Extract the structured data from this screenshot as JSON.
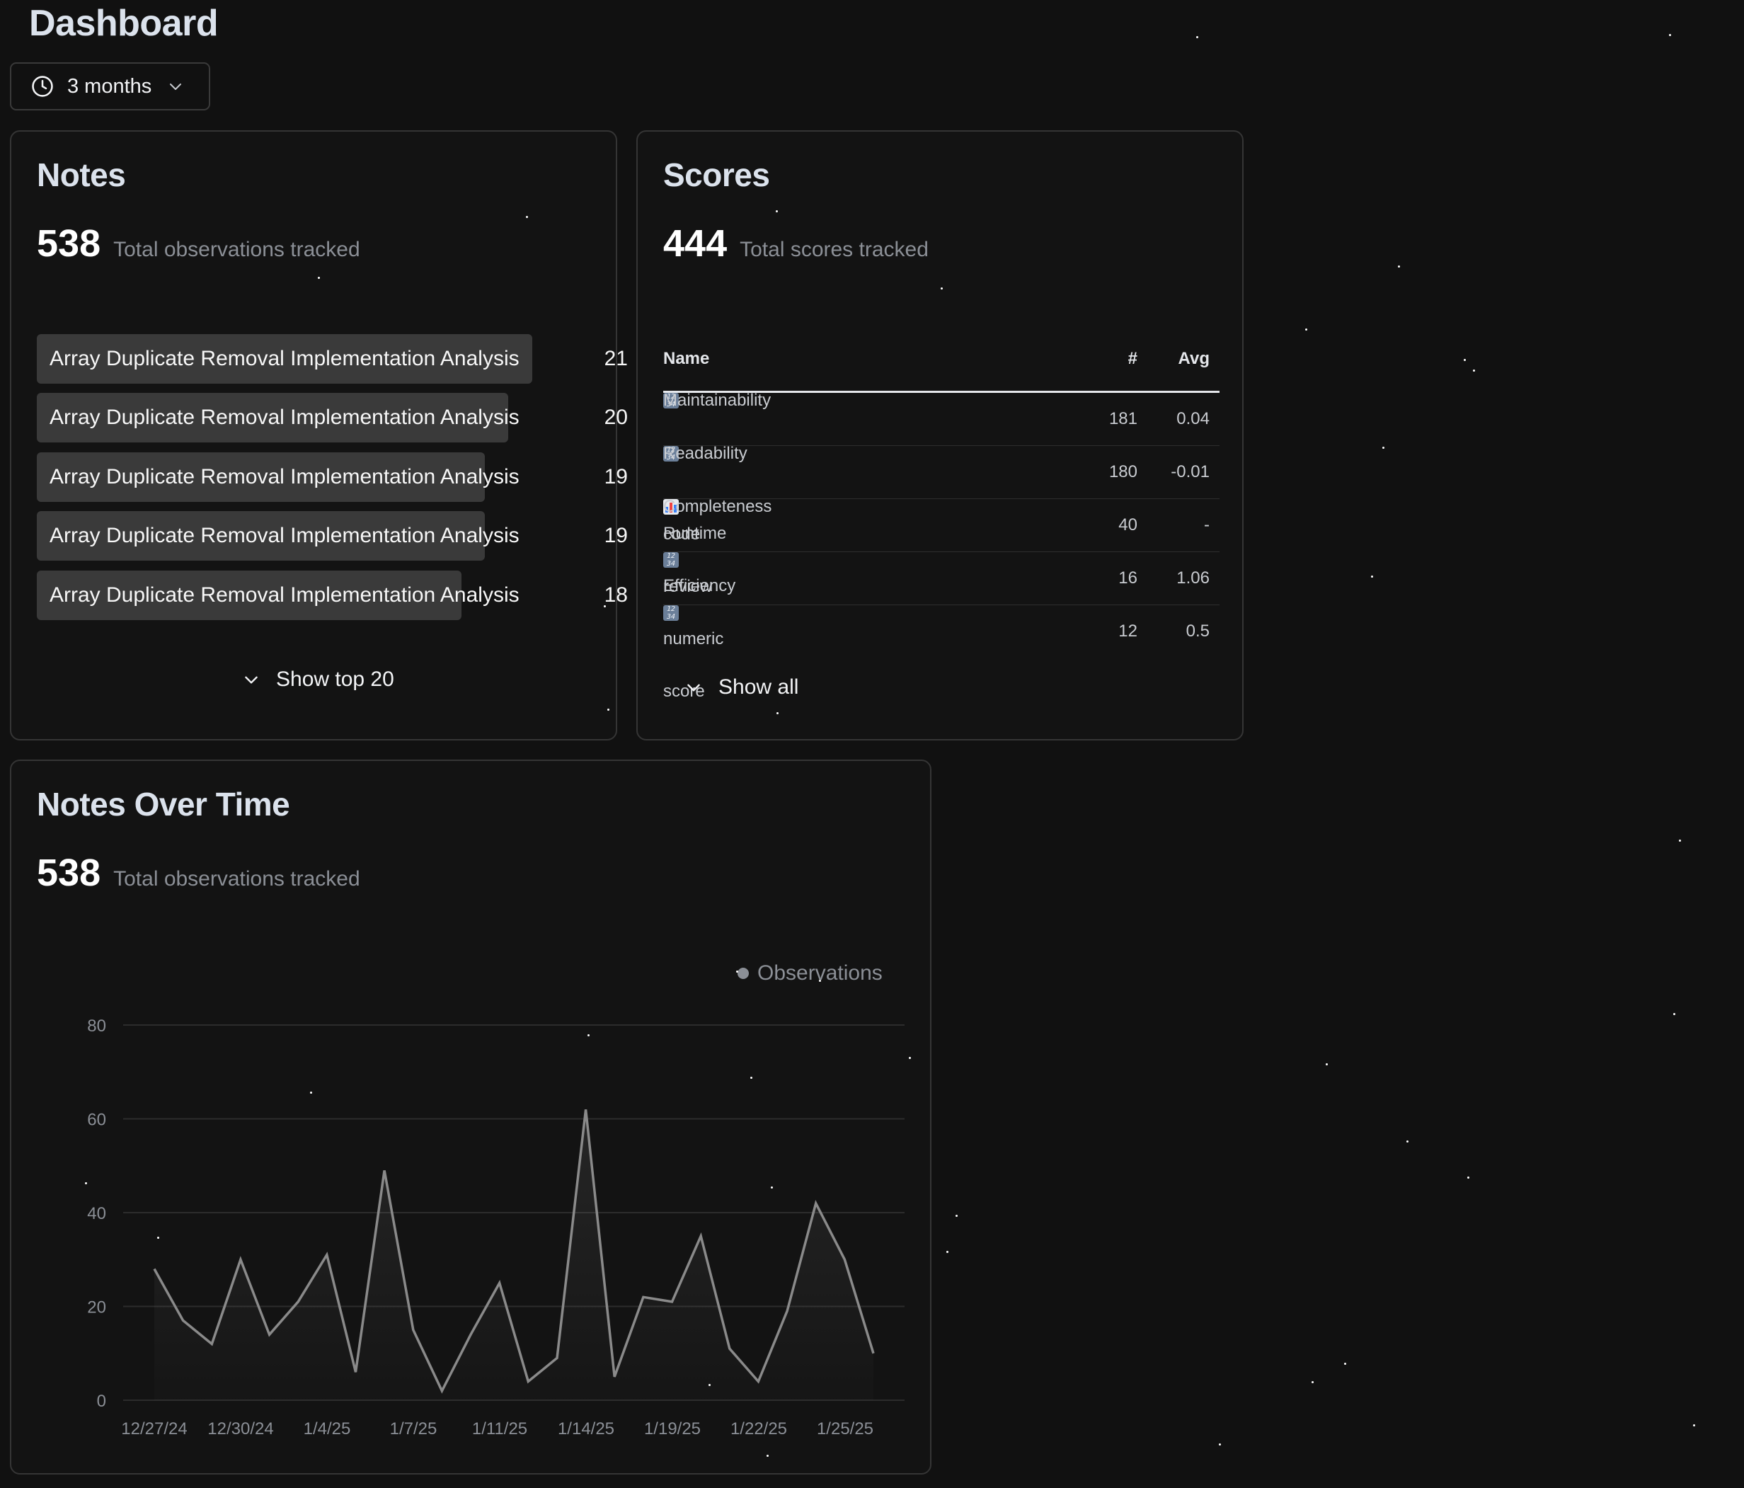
{
  "page": {
    "title": "Dashboard"
  },
  "range_select": {
    "value": "3 months",
    "icon": "clock-icon"
  },
  "notes_card": {
    "title": "Notes",
    "total": "538",
    "total_label": "Total observations tracked",
    "items": [
      {
        "label": "Array Duplicate Removal Implementation Analysis",
        "count": "21",
        "value": 21
      },
      {
        "label": "Array Duplicate Removal Implementation Analysis",
        "count": "20",
        "value": 20
      },
      {
        "label": "Array Duplicate Removal Implementation Analysis",
        "count": "19",
        "value": 19
      },
      {
        "label": "Array Duplicate Removal Implementation Analysis",
        "count": "19",
        "value": 19
      },
      {
        "label": "Array Duplicate Removal Implementation Analysis",
        "count": "18",
        "value": 18
      }
    ],
    "show_more_label": "Show top 20"
  },
  "scores_card": {
    "title": "Scores",
    "total": "444",
    "total_label": "Total scores tracked",
    "columns": {
      "name": "Name",
      "count": "#",
      "avg": "Avg"
    },
    "rows": [
      {
        "icon": "numeric-icon",
        "name": "Maintainability",
        "count": "181",
        "avg": "0.04"
      },
      {
        "icon": "numeric-icon",
        "name": "Readability",
        "count": "180",
        "avg": "-0.01"
      },
      {
        "icon": "bar-chart-icon",
        "name": "Completeness",
        "count": "40",
        "avg": "-"
      },
      {
        "icon": "numeric-icon",
        "name": "Runtime Efficiency",
        "count": "16",
        "avg": "1.06"
      },
      {
        "icon": "numeric-icon",
        "name": "code review numeric score",
        "count": "12",
        "avg": "0.5"
      }
    ],
    "show_all_label": "Show all"
  },
  "timeline_card": {
    "title": "Notes Over Time",
    "total": "538",
    "total_label": "Total observations tracked"
  },
  "colors": {
    "background": "#111111",
    "card_border": "#353535",
    "bar": "#3a3a3a",
    "line": "#8a8a8a",
    "muted_text": "#8b8f96"
  },
  "chart_data": {
    "type": "line",
    "title": "",
    "xlabel": "",
    "ylabel": "",
    "ylim": [
      0,
      80
    ],
    "y_ticks": [
      "0",
      "20",
      "40",
      "60",
      "80"
    ],
    "x_tick_labels": [
      "12/27/24",
      "12/30/24",
      "1/4/25",
      "1/7/25",
      "1/11/25",
      "1/14/25",
      "1/19/25",
      "1/22/25",
      "1/25/25"
    ],
    "legend": "top-right",
    "series": [
      {
        "name": "Observations",
        "values": [
          28,
          17,
          12,
          30,
          14,
          21,
          31,
          6,
          49,
          15,
          2,
          14,
          25,
          4,
          9,
          62,
          5,
          22,
          21,
          35,
          11,
          4,
          19,
          42,
          30,
          10
        ]
      }
    ]
  }
}
